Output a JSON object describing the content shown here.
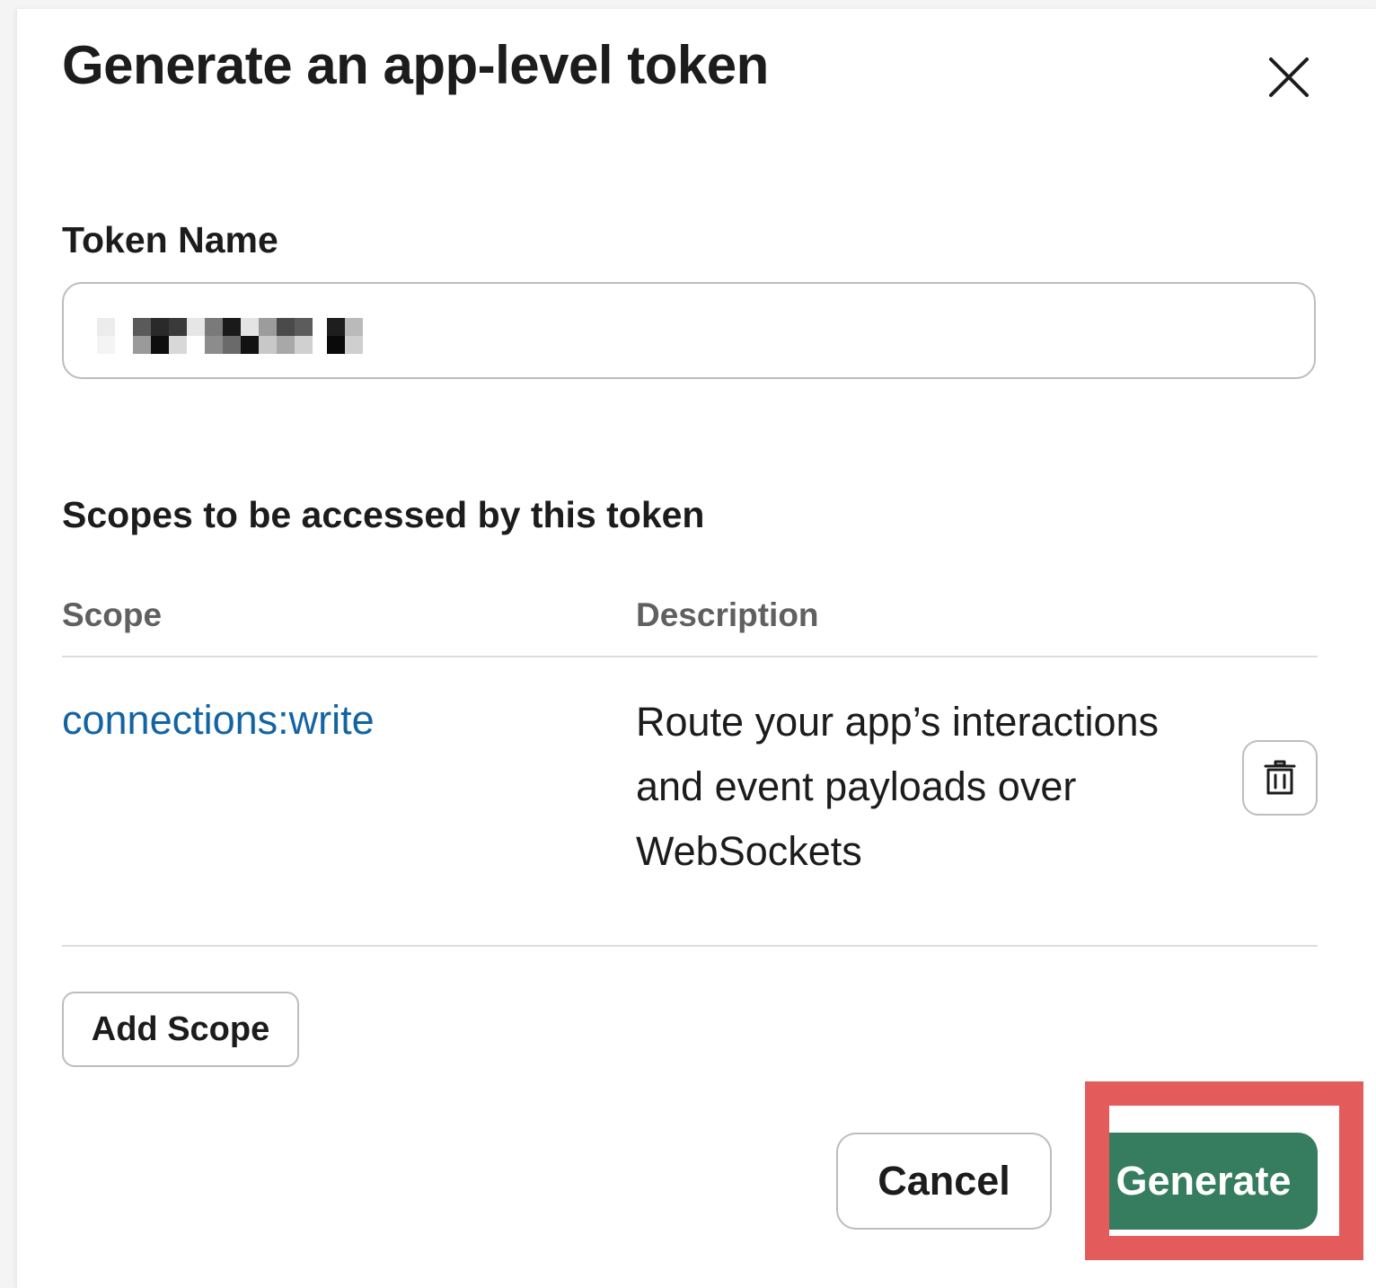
{
  "dialog": {
    "title": "Generate an app-level token",
    "close_icon": "close-icon"
  },
  "token_name": {
    "label": "Token Name",
    "value_redacted": true
  },
  "scopes": {
    "heading": "Scopes to be accessed by this token",
    "columns": [
      "Scope",
      "Description"
    ],
    "rows": [
      {
        "scope": "connections:write",
        "description": "Route your app’s interactions and event payloads over WebSockets",
        "delete_icon": "trash-icon"
      }
    ],
    "add_label": "Add Scope"
  },
  "footer": {
    "cancel_label": "Cancel",
    "generate_label": "Generate"
  },
  "colors": {
    "primary_green": "#357d5e",
    "link_blue": "#1264a3",
    "highlight_red": "#e35b5b"
  }
}
